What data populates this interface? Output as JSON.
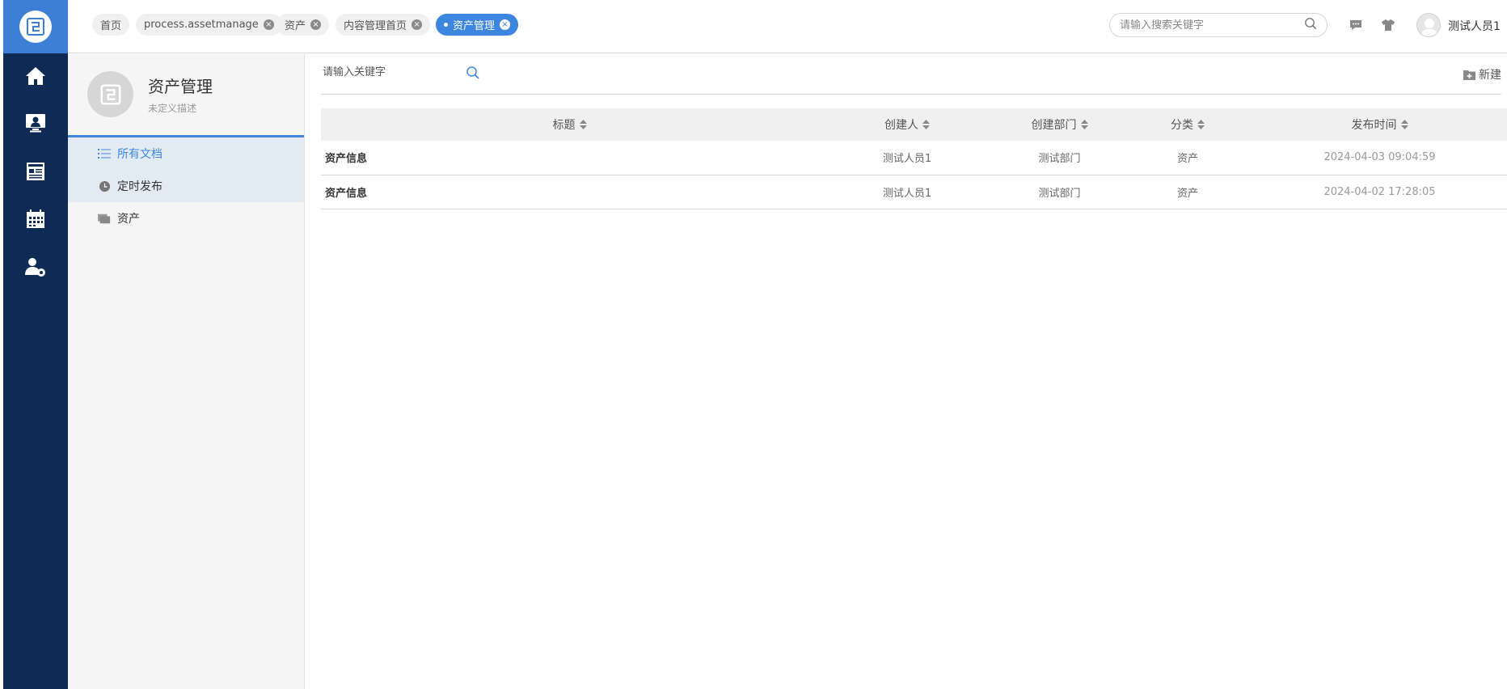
{
  "rail": {
    "items": [
      {
        "name": "home-icon"
      },
      {
        "name": "monitor-user-icon"
      },
      {
        "name": "news-icon"
      },
      {
        "name": "calendar-icon"
      },
      {
        "name": "user-settings-icon"
      }
    ]
  },
  "tabs": [
    {
      "label": "首页"
    },
    {
      "label": "process.assetmanage"
    },
    {
      "label": "资产"
    },
    {
      "label": "内容管理首页"
    },
    {
      "label": "资产管理",
      "active": true
    }
  ],
  "topbar": {
    "search_placeholder": "请输入搜索关键字",
    "username": "测试人员1"
  },
  "sidebar": {
    "title": "资产管理",
    "description": "未定义描述",
    "items": [
      {
        "label": "所有文档",
        "icon": "list-icon"
      },
      {
        "label": "定时发布",
        "icon": "clock-icon"
      },
      {
        "label": "资产",
        "icon": "folder-icon"
      }
    ]
  },
  "main": {
    "search_placeholder": "请输入关键字",
    "new_label": "新建",
    "columns": [
      "标题",
      "创建人",
      "创建部门",
      "分类",
      "发布时间"
    ],
    "rows": [
      {
        "title": "资产信息",
        "creator": "测试人员1",
        "dept": "测试部门",
        "category": "资产",
        "time": "2024-04-03 09:04:59"
      },
      {
        "title": "资产信息",
        "creator": "测试人员1",
        "dept": "测试部门",
        "category": "资产",
        "time": "2024-04-02 17:28:05"
      }
    ]
  },
  "colors": {
    "rail": "#0e2b56",
    "accent": "#3d86e0"
  }
}
